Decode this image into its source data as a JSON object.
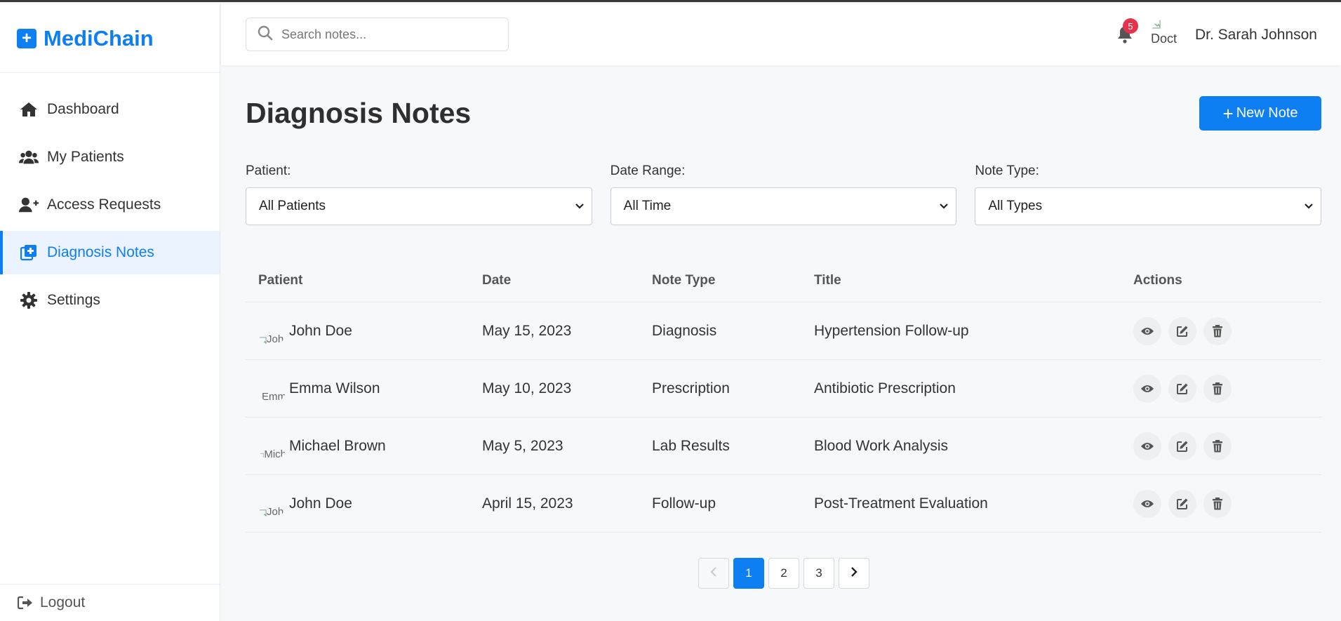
{
  "app": {
    "name": "MediChain",
    "brand_color": "#0d7ff2"
  },
  "sidebar": {
    "items": [
      {
        "label": "Dashboard",
        "icon": "home-icon"
      },
      {
        "label": "My Patients",
        "icon": "users-icon"
      },
      {
        "label": "Access Requests",
        "icon": "user-plus-icon"
      },
      {
        "label": "Diagnosis Notes",
        "icon": "notes-medical-icon",
        "active": true
      },
      {
        "label": "Settings",
        "icon": "gear-icon"
      }
    ],
    "logout_label": "Logout"
  },
  "header": {
    "search_placeholder": "Search notes...",
    "notification_count": "5",
    "avatar_alt": "Doct",
    "user_name": "Dr. Sarah Johnson"
  },
  "page": {
    "title": "Diagnosis Notes",
    "new_button_label": "New Note"
  },
  "filters": [
    {
      "label": "Patient:",
      "value": "All Patients"
    },
    {
      "label": "Date Range:",
      "value": "All Time"
    },
    {
      "label": "Note Type:",
      "value": "All Types"
    }
  ],
  "table": {
    "columns": [
      "Patient",
      "Date",
      "Note Type",
      "Title",
      "Actions"
    ],
    "rows": [
      {
        "avatar_alt": "Joh",
        "patient": "John Doe",
        "date": "May 15, 2023",
        "type": "Diagnosis",
        "title": "Hypertension Follow-up"
      },
      {
        "avatar_alt": "Emm",
        "patient": "Emma Wilson",
        "date": "May 10, 2023",
        "type": "Prescription",
        "title": "Antibiotic Prescription"
      },
      {
        "avatar_alt": "Mich",
        "patient": "Michael Brown",
        "date": "May 5, 2023",
        "type": "Lab Results",
        "title": "Blood Work Analysis"
      },
      {
        "avatar_alt": "Joh",
        "patient": "John Doe",
        "date": "April 15, 2023",
        "type": "Follow-up",
        "title": "Post-Treatment Evaluation"
      }
    ]
  },
  "pagination": {
    "pages": [
      "1",
      "2",
      "3"
    ],
    "current": "1"
  }
}
